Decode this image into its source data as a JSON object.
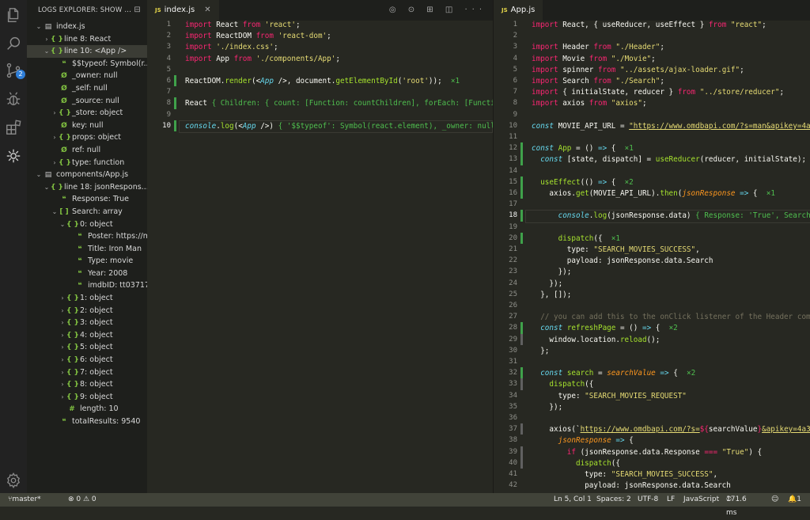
{
  "colors": {
    "activity": "#222222",
    "sidebar": "#1e1f1c",
    "editor": "#272822",
    "status": "#414339",
    "badge": "#2f7ed8",
    "added": "#3fa14a"
  },
  "activity": {
    "icons": [
      "files-icon",
      "search-icon",
      "source-control-icon",
      "debug-icon",
      "extensions-icon",
      "logs-explorer-icon",
      "settings-gear-icon"
    ],
    "badge": "2"
  },
  "sidebar": {
    "title": "LOGS EXPLORER: SHOW ...",
    "tree": [
      {
        "d": 0,
        "tw": "v",
        "ic": "file",
        "t": "index.js"
      },
      {
        "d": 1,
        "tw": ">",
        "ic": "obj",
        "t": "line 8: React"
      },
      {
        "d": 1,
        "tw": "v",
        "ic": "obj",
        "t": "line 10: <App />",
        "sel": true
      },
      {
        "d": 2,
        "tw": "",
        "ic": "str",
        "t": "$$typeof: Symbol(r..."
      },
      {
        "d": 2,
        "tw": "",
        "ic": "null",
        "t": "_owner: null"
      },
      {
        "d": 2,
        "tw": "",
        "ic": "null",
        "t": "_self: null"
      },
      {
        "d": 2,
        "tw": "",
        "ic": "null",
        "t": "_source: null"
      },
      {
        "d": 2,
        "tw": ">",
        "ic": "obj",
        "t": "_store: object"
      },
      {
        "d": 2,
        "tw": "",
        "ic": "null",
        "t": "key: null"
      },
      {
        "d": 2,
        "tw": ">",
        "ic": "obj",
        "t": "props: object"
      },
      {
        "d": 2,
        "tw": "",
        "ic": "null",
        "t": "ref: null"
      },
      {
        "d": 2,
        "tw": ">",
        "ic": "obj",
        "t": "type: function"
      },
      {
        "d": 0,
        "tw": "v",
        "ic": "file",
        "t": "components/App.js"
      },
      {
        "d": 1,
        "tw": "v",
        "ic": "obj",
        "t": "line 18: jsonRespons..."
      },
      {
        "d": 2,
        "tw": "",
        "ic": "str",
        "t": "Response: True"
      },
      {
        "d": 2,
        "tw": "v",
        "ic": "arr",
        "t": "Search: array"
      },
      {
        "d": 3,
        "tw": "v",
        "ic": "obj",
        "t": "0: object"
      },
      {
        "d": 4,
        "tw": "",
        "ic": "str",
        "t": "Poster: https://m..."
      },
      {
        "d": 4,
        "tw": "",
        "ic": "str",
        "t": "Title: Iron Man"
      },
      {
        "d": 4,
        "tw": "",
        "ic": "str",
        "t": "Type: movie"
      },
      {
        "d": 4,
        "tw": "",
        "ic": "str",
        "t": "Year: 2008"
      },
      {
        "d": 4,
        "tw": "",
        "ic": "str",
        "t": "imdbID: tt0371746"
      },
      {
        "d": 3,
        "tw": ">",
        "ic": "obj",
        "t": "1: object"
      },
      {
        "d": 3,
        "tw": ">",
        "ic": "obj",
        "t": "2: object"
      },
      {
        "d": 3,
        "tw": ">",
        "ic": "obj",
        "t": "3: object"
      },
      {
        "d": 3,
        "tw": ">",
        "ic": "obj",
        "t": "4: object"
      },
      {
        "d": 3,
        "tw": ">",
        "ic": "obj",
        "t": "5: object"
      },
      {
        "d": 3,
        "tw": ">",
        "ic": "obj",
        "t": "6: object"
      },
      {
        "d": 3,
        "tw": ">",
        "ic": "obj",
        "t": "7: object"
      },
      {
        "d": 3,
        "tw": ">",
        "ic": "obj",
        "t": "8: object"
      },
      {
        "d": 3,
        "tw": ">",
        "ic": "obj",
        "t": "9: object"
      },
      {
        "d": 3,
        "tw": "",
        "ic": "num",
        "t": "length: 10"
      },
      {
        "d": 2,
        "tw": "",
        "ic": "str",
        "t": "totalResults: 9540"
      }
    ]
  },
  "editor1": {
    "tab": "index.js",
    "lines": [
      {
        "n": "1",
        "g": "",
        "tokens": [
          [
            "import",
            "k"
          ],
          " React ",
          [
            "from",
            "k"
          ],
          " ",
          [
            "'react'",
            "s"
          ],
          ";"
        ]
      },
      {
        "n": "2",
        "g": "",
        "tokens": [
          [
            "import",
            "k"
          ],
          " ReactDOM ",
          [
            "from",
            "k"
          ],
          " ",
          [
            "'react-dom'",
            "s"
          ],
          ";"
        ]
      },
      {
        "n": "3",
        "g": "",
        "tokens": [
          [
            "import",
            "k"
          ],
          " ",
          [
            "'./index.css'",
            "s"
          ],
          ";"
        ]
      },
      {
        "n": "4",
        "g": "",
        "tokens": [
          [
            "import",
            "k"
          ],
          " App ",
          [
            "from",
            "k"
          ],
          " ",
          [
            "'./components/App'",
            "s"
          ],
          ";"
        ]
      },
      {
        "n": "5",
        "g": "",
        "tokens": [
          ""
        ]
      },
      {
        "n": "6",
        "g": "add",
        "tokens": [
          "ReactDOM.",
          [
            "render",
            "f"
          ],
          "(<",
          [
            "App",
            "b"
          ],
          " />, document.",
          [
            "getElementById",
            "f"
          ],
          "(",
          [
            "'root'",
            "s"
          ],
          "));  ",
          [
            "×1",
            "g"
          ]
        ]
      },
      {
        "n": "7",
        "g": "",
        "tokens": [
          ""
        ]
      },
      {
        "n": "8",
        "g": "add",
        "tokens": [
          "React ",
          [
            "{ Children: { count: [Function: countChildren], forEach: [Functi",
            "g"
          ]
        ]
      },
      {
        "n": "9",
        "g": "",
        "tokens": [
          ""
        ]
      },
      {
        "n": "10",
        "g": "add",
        "cur": true,
        "tokens": [
          [
            "console",
            "b"
          ],
          ".",
          [
            "log",
            "f"
          ],
          "(<",
          [
            "App",
            "b"
          ],
          " />) ",
          [
            "{ '$$typeof': Symbol(react.element), _owner: null",
            "g"
          ]
        ]
      }
    ]
  },
  "editor2": {
    "tab": "App.js",
    "lines": [
      {
        "n": "1",
        "g": "",
        "tokens": [
          [
            "import",
            "k"
          ],
          " React, { useReducer, useEffect } ",
          [
            "from",
            "k"
          ],
          " ",
          [
            "\"react\"",
            "s"
          ],
          ";"
        ]
      },
      {
        "n": "2",
        "g": "",
        "tokens": [
          ""
        ]
      },
      {
        "n": "3",
        "g": "",
        "tokens": [
          [
            "import",
            "k"
          ],
          " Header ",
          [
            "from",
            "k"
          ],
          " ",
          [
            "\"./Header\"",
            "s"
          ],
          ";"
        ]
      },
      {
        "n": "4",
        "g": "",
        "tokens": [
          [
            "import",
            "k"
          ],
          " Movie ",
          [
            "from",
            "k"
          ],
          " ",
          [
            "\"./Movie\"",
            "s"
          ],
          ";"
        ]
      },
      {
        "n": "5",
        "g": "",
        "tokens": [
          [
            "import",
            "k"
          ],
          " spinner ",
          [
            "from",
            "k"
          ],
          " ",
          [
            "\"../assets/ajax-loader.gif\"",
            "s"
          ],
          ";"
        ]
      },
      {
        "n": "6",
        "g": "",
        "tokens": [
          [
            "import",
            "k"
          ],
          " Search ",
          [
            "from",
            "k"
          ],
          " ",
          [
            "\"./Search\"",
            "s"
          ],
          ";"
        ]
      },
      {
        "n": "7",
        "g": "",
        "tokens": [
          [
            "import",
            "k"
          ],
          " { initialState, reducer } ",
          [
            "from",
            "k"
          ],
          " ",
          [
            "\"../store/reducer\"",
            "s"
          ],
          ";"
        ]
      },
      {
        "n": "8",
        "g": "",
        "tokens": [
          [
            "import",
            "k"
          ],
          " axios ",
          [
            "from",
            "k"
          ],
          " ",
          [
            "\"axios\"",
            "s"
          ],
          ";"
        ]
      },
      {
        "n": "9",
        "g": "",
        "tokens": [
          ""
        ]
      },
      {
        "n": "10",
        "g": "",
        "tokens": [
          [
            "const",
            "b"
          ],
          " MOVIE_API_URL = ",
          [
            "\"https://www.omdbapi.com/?s=man&apikey=4a3",
            "u"
          ]
        ]
      },
      {
        "n": "11",
        "g": "",
        "tokens": [
          ""
        ]
      },
      {
        "n": "12",
        "g": "add",
        "tokens": [
          [
            "const",
            "b"
          ],
          " ",
          [
            "App",
            "f"
          ],
          " = () ",
          [
            "=>",
            "b"
          ],
          " {  ",
          [
            "×1",
            "g"
          ]
        ]
      },
      {
        "n": "13",
        "g": "add",
        "tokens": [
          "  ",
          [
            "const",
            "b"
          ],
          " [state, dispatch] = ",
          [
            "useReducer",
            "f"
          ],
          "(reducer, initialState);"
        ]
      },
      {
        "n": "14",
        "g": "",
        "tokens": [
          ""
        ]
      },
      {
        "n": "15",
        "g": "add",
        "tokens": [
          "  ",
          [
            "useEffect",
            "f"
          ],
          "(() ",
          [
            "=>",
            "b"
          ],
          " {  ",
          [
            "×2",
            "g"
          ]
        ]
      },
      {
        "n": "16",
        "g": "add",
        "tokens": [
          "    axios.",
          [
            "get",
            "f"
          ],
          "(MOVIE_API_URL).",
          [
            "then",
            "f"
          ],
          "(",
          [
            "jsonResponse",
            "p"
          ],
          " ",
          [
            "=>",
            "b"
          ],
          " {  ",
          [
            "×1",
            "g"
          ]
        ]
      },
      {
        "n": "17",
        "g": "",
        "tokens": [
          ""
        ]
      },
      {
        "n": "18",
        "g": "add",
        "cur": true,
        "tokens": [
          "      ",
          [
            "console",
            "b"
          ],
          ".",
          [
            "log",
            "f"
          ],
          "(jsonResponse.data) ",
          [
            "{ Response: 'True', Search:",
            "g"
          ]
        ]
      },
      {
        "n": "19",
        "g": "",
        "tokens": [
          ""
        ]
      },
      {
        "n": "20",
        "g": "add",
        "tokens": [
          "      ",
          [
            "dispatch",
            "f"
          ],
          "({  ",
          [
            "×1",
            "g"
          ]
        ]
      },
      {
        "n": "21",
        "g": "",
        "tokens": [
          "        type: ",
          [
            "\"SEARCH_MOVIES_SUCCESS\"",
            "s"
          ],
          ","
        ]
      },
      {
        "n": "22",
        "g": "",
        "tokens": [
          "        payload: jsonResponse.data.Search"
        ]
      },
      {
        "n": "23",
        "g": "",
        "tokens": [
          "      });"
        ]
      },
      {
        "n": "24",
        "g": "",
        "tokens": [
          "    });"
        ]
      },
      {
        "n": "25",
        "g": "",
        "tokens": [
          "  }, []);"
        ]
      },
      {
        "n": "26",
        "g": "",
        "tokens": [
          ""
        ]
      },
      {
        "n": "27",
        "g": "",
        "tokens": [
          "  ",
          [
            "// you can add this to the onClick listener of the Header comp",
            "c"
          ]
        ]
      },
      {
        "n": "28",
        "g": "add",
        "tokens": [
          "  ",
          [
            "const",
            "b"
          ],
          " ",
          [
            "refreshPage",
            "f"
          ],
          " = () ",
          [
            "=>",
            "b"
          ],
          " {  ",
          [
            "×2",
            "g"
          ]
        ]
      },
      {
        "n": "29",
        "g": "mod",
        "tokens": [
          "    window.location.",
          [
            "reload",
            "f"
          ],
          "();"
        ]
      },
      {
        "n": "30",
        "g": "",
        "tokens": [
          "  };"
        ]
      },
      {
        "n": "31",
        "g": "",
        "tokens": [
          ""
        ]
      },
      {
        "n": "32",
        "g": "add",
        "tokens": [
          "  ",
          [
            "const",
            "b"
          ],
          " ",
          [
            "search",
            "f"
          ],
          " = ",
          [
            "searchValue",
            "p"
          ],
          " ",
          [
            "=>",
            "b"
          ],
          " {  ",
          [
            "×2",
            "g"
          ]
        ]
      },
      {
        "n": "33",
        "g": "mod",
        "tokens": [
          "    ",
          [
            "dispatch",
            "f"
          ],
          "({"
        ]
      },
      {
        "n": "34",
        "g": "",
        "tokens": [
          "      type: ",
          [
            "\"SEARCH_MOVIES_REQUEST\"",
            "s"
          ]
        ]
      },
      {
        "n": "35",
        "g": "",
        "tokens": [
          "    });"
        ]
      },
      {
        "n": "36",
        "g": "",
        "tokens": [
          ""
        ]
      },
      {
        "n": "37",
        "g": "mod",
        "tokens": [
          "    axios(`",
          [
            "https://www.omdbapi.com/?s=",
            "u"
          ],
          [
            "${",
            "k"
          ],
          "searchValue",
          [
            "}",
            "k"
          ],
          [
            "&apikey=4a3b",
            "u"
          ]
        ]
      },
      {
        "n": "38",
        "g": "",
        "tokens": [
          "      ",
          [
            "jsonResponse",
            "p"
          ],
          " ",
          [
            "=>",
            "b"
          ],
          " {"
        ]
      },
      {
        "n": "39",
        "g": "mod",
        "tokens": [
          "        ",
          [
            "if",
            "k"
          ],
          " (jsonResponse.data.Response ",
          [
            "===",
            "k"
          ],
          " ",
          [
            "\"True\"",
            "s"
          ],
          ") {"
        ]
      },
      {
        "n": "40",
        "g": "mod",
        "tokens": [
          "          ",
          [
            "dispatch",
            "f"
          ],
          "({"
        ]
      },
      {
        "n": "41",
        "g": "",
        "tokens": [
          "            type: ",
          [
            "\"SEARCH_MOVIES_SUCCESS\"",
            "s"
          ],
          ","
        ]
      },
      {
        "n": "42",
        "g": "",
        "tokens": [
          "            payload: jsonResponse.data.Search"
        ]
      }
    ]
  },
  "status": {
    "branch": "master*",
    "problems": "⊗ 0 ⚠ 0",
    "position": "Ln 5, Col 1",
    "spaces": "Spaces: 2",
    "encoding": "UTF-8",
    "eol": "LF",
    "language": "JavaScript",
    "timing": "171.6 ms",
    "notifications": "1"
  }
}
